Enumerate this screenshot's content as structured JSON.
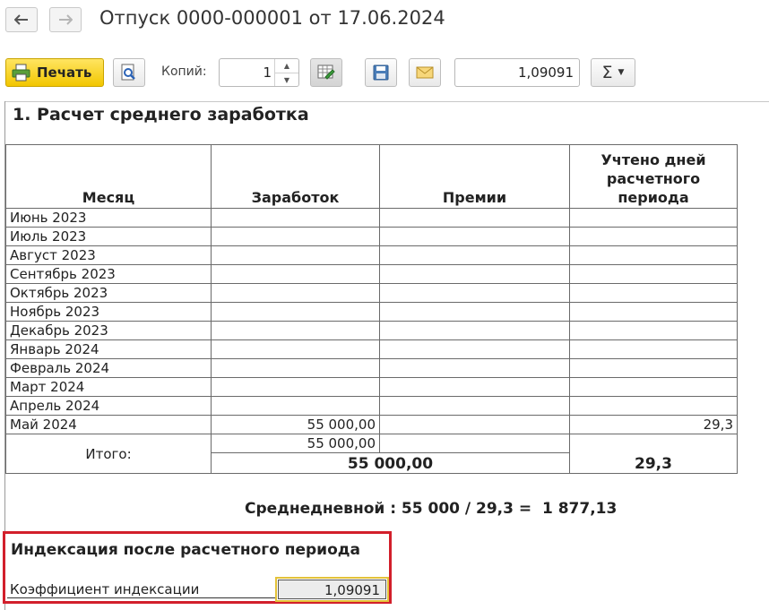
{
  "window": {
    "title": "Отпуск 0000-000001 от 17.06.2024"
  },
  "toolbar": {
    "print_label": "Печать",
    "copies_label": "Копий:",
    "copies_value": "1",
    "value_field": "1,09091",
    "sigma_label": "Σ"
  },
  "report": {
    "section_title": "1. Расчет среднего заработка",
    "headers": {
      "month": "Месяц",
      "earnings": "Заработок",
      "bonuses": "Премии",
      "days": "Учтено дней расчетного периода"
    },
    "rows": [
      {
        "month": "Июнь 2023",
        "earnings": "",
        "bonuses": "",
        "days": ""
      },
      {
        "month": "Июль 2023",
        "earnings": "",
        "bonuses": "",
        "days": ""
      },
      {
        "month": "Август 2023",
        "earnings": "",
        "bonuses": "",
        "days": ""
      },
      {
        "month": "Сентябрь 2023",
        "earnings": "",
        "bonuses": "",
        "days": ""
      },
      {
        "month": "Октябрь 2023",
        "earnings": "",
        "bonuses": "",
        "days": ""
      },
      {
        "month": "Ноябрь 2023",
        "earnings": "",
        "bonuses": "",
        "days": ""
      },
      {
        "month": "Декабрь 2023",
        "earnings": "",
        "bonuses": "",
        "days": ""
      },
      {
        "month": "Январь 2024",
        "earnings": "",
        "bonuses": "",
        "days": ""
      },
      {
        "month": "Февраль 2024",
        "earnings": "",
        "bonuses": "",
        "days": ""
      },
      {
        "month": "Март 2024",
        "earnings": "",
        "bonuses": "",
        "days": ""
      },
      {
        "month": "Апрель 2024",
        "earnings": "",
        "bonuses": "",
        "days": ""
      },
      {
        "month": "Май 2024",
        "earnings": "55 000,00",
        "bonuses": "",
        "days": "29,3"
      }
    ],
    "totals": {
      "label": "Итого:",
      "earnings_sub": "55 000,00",
      "earnings_total": "55 000,00",
      "days_total": "29,3"
    },
    "average_line": "Среднедневной : 55 000 / 29,3 =  1 877,13",
    "indexation": {
      "title": "Индексация после расчетного периода",
      "label": "Коэффициент индексации",
      "value": "1,09091"
    }
  },
  "colors": {
    "print_button": "#f2c600",
    "highlight_frame": "#d21f2b",
    "field_outline": "#e3c23a"
  }
}
